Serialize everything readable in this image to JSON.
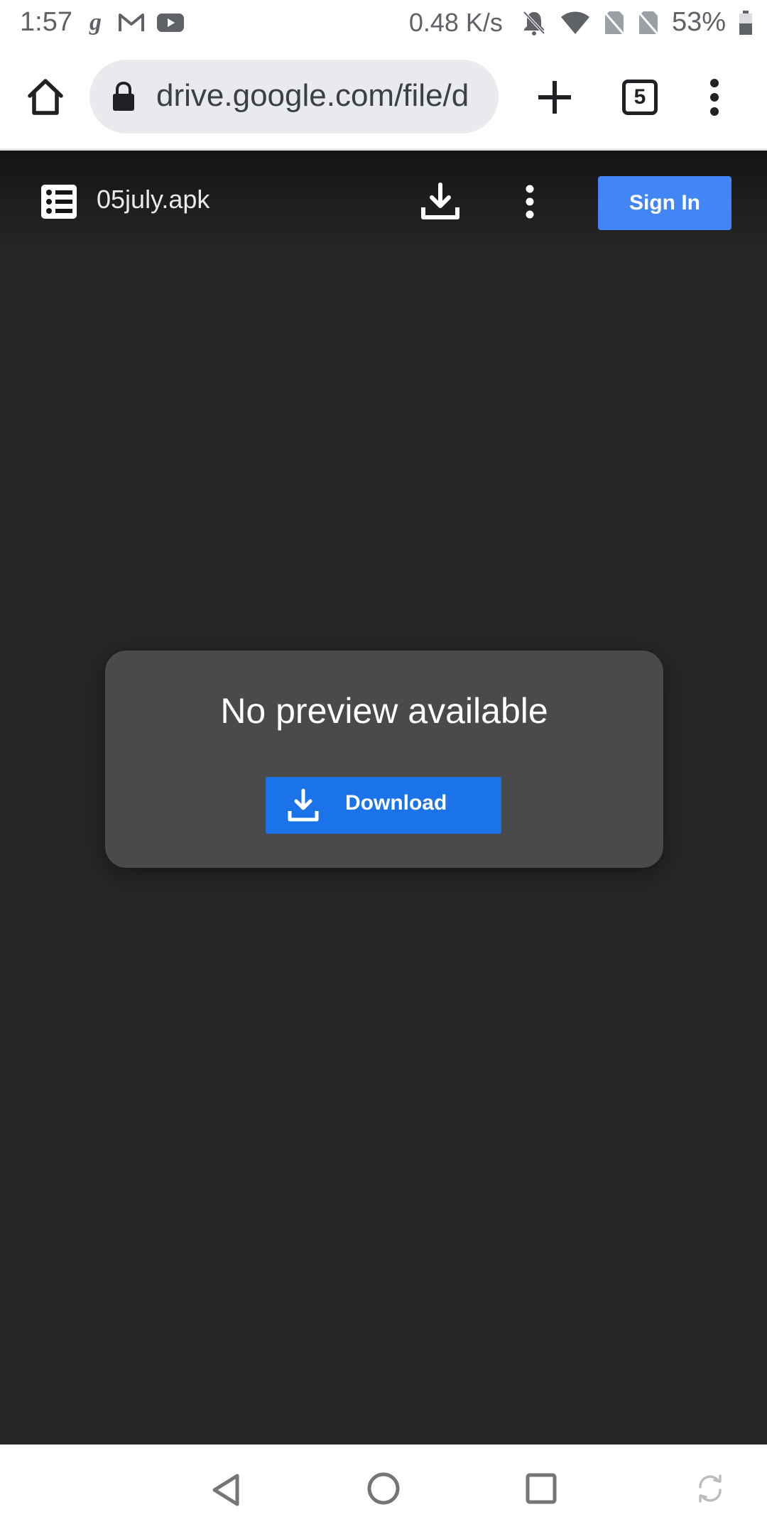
{
  "status_bar": {
    "time": "1:57",
    "notification_icons": [
      "g-app-icon",
      "gmail-icon",
      "youtube-icon"
    ],
    "network_speed": "0.48 K/s",
    "status_icons": [
      "bell-off-icon",
      "wifi-icon",
      "no-sim-icon",
      "no-sim-icon"
    ],
    "battery_percent": "53%"
  },
  "browser": {
    "url": "drive.google.com/file/d",
    "tab_count": "5"
  },
  "viewer": {
    "file_name": "05july.apk",
    "sign_in_label": "Sign In",
    "preview_message": "No preview available",
    "download_label": "Download"
  },
  "colors": {
    "viewer_bg": "#262626",
    "card_bg": "#4a494b",
    "sign_in_blue": "#4285f4",
    "download_blue": "#1a73e8"
  }
}
